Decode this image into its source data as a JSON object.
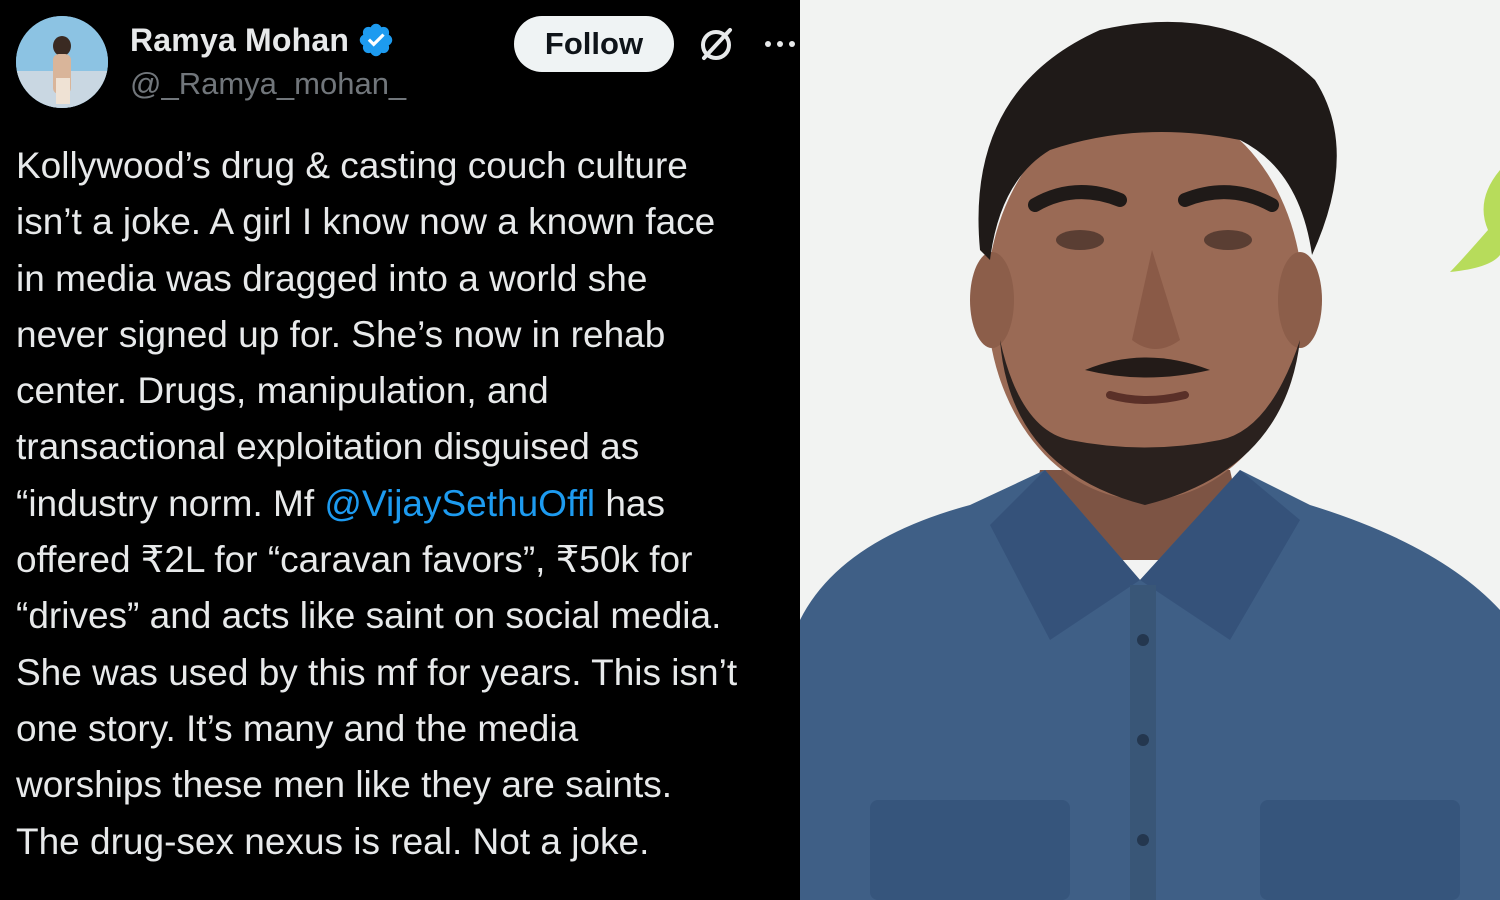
{
  "tweet": {
    "display_name": "Ramya Mohan",
    "handle": "@_Ramya_mohan_",
    "follow_label": "Follow",
    "verified_icon": "verified-badge-icon",
    "grok_icon": "grok-icon",
    "more_icon": "more-options-icon",
    "colors": {
      "background": "#000000",
      "text": "#e7e9ea",
      "handle": "#71767b",
      "mention": "#1d9bf0",
      "verified": "#1d9bf0"
    },
    "lines": [
      {
        "text": "Kollywood’s drug & casting couch culture"
      },
      {
        "text": "isn’t a joke. A girl I know now a known face"
      },
      {
        "text": "in media was dragged into a world she"
      },
      {
        "text": "never signed up for. She’s now in  rehab"
      },
      {
        "text": "center. Drugs, manipulation, and"
      },
      {
        "text": "transactional exploitation disguised as"
      },
      {
        "before": "“industry norm. Mf ",
        "mention": "@VijaySethuOffl",
        "after": " has"
      },
      {
        "text": "offered ₹2L for “caravan favors”, ₹50k for"
      },
      {
        "text": "“drives” and acts like saint on social media."
      },
      {
        "text": "She was used by this mf for years. This isn’t"
      },
      {
        "text": "one story. It’s many and the media"
      },
      {
        "text": "worships these men like they are saints."
      },
      {
        "text": "The drug-sex nexus is real. Not a joke."
      }
    ]
  },
  "photo": {
    "subject": "man-portrait",
    "colors": {
      "background": "#f2f3f2",
      "shirt": "#3f5f86",
      "skin": "#9a6a55",
      "hair": "#1f1a18"
    }
  }
}
